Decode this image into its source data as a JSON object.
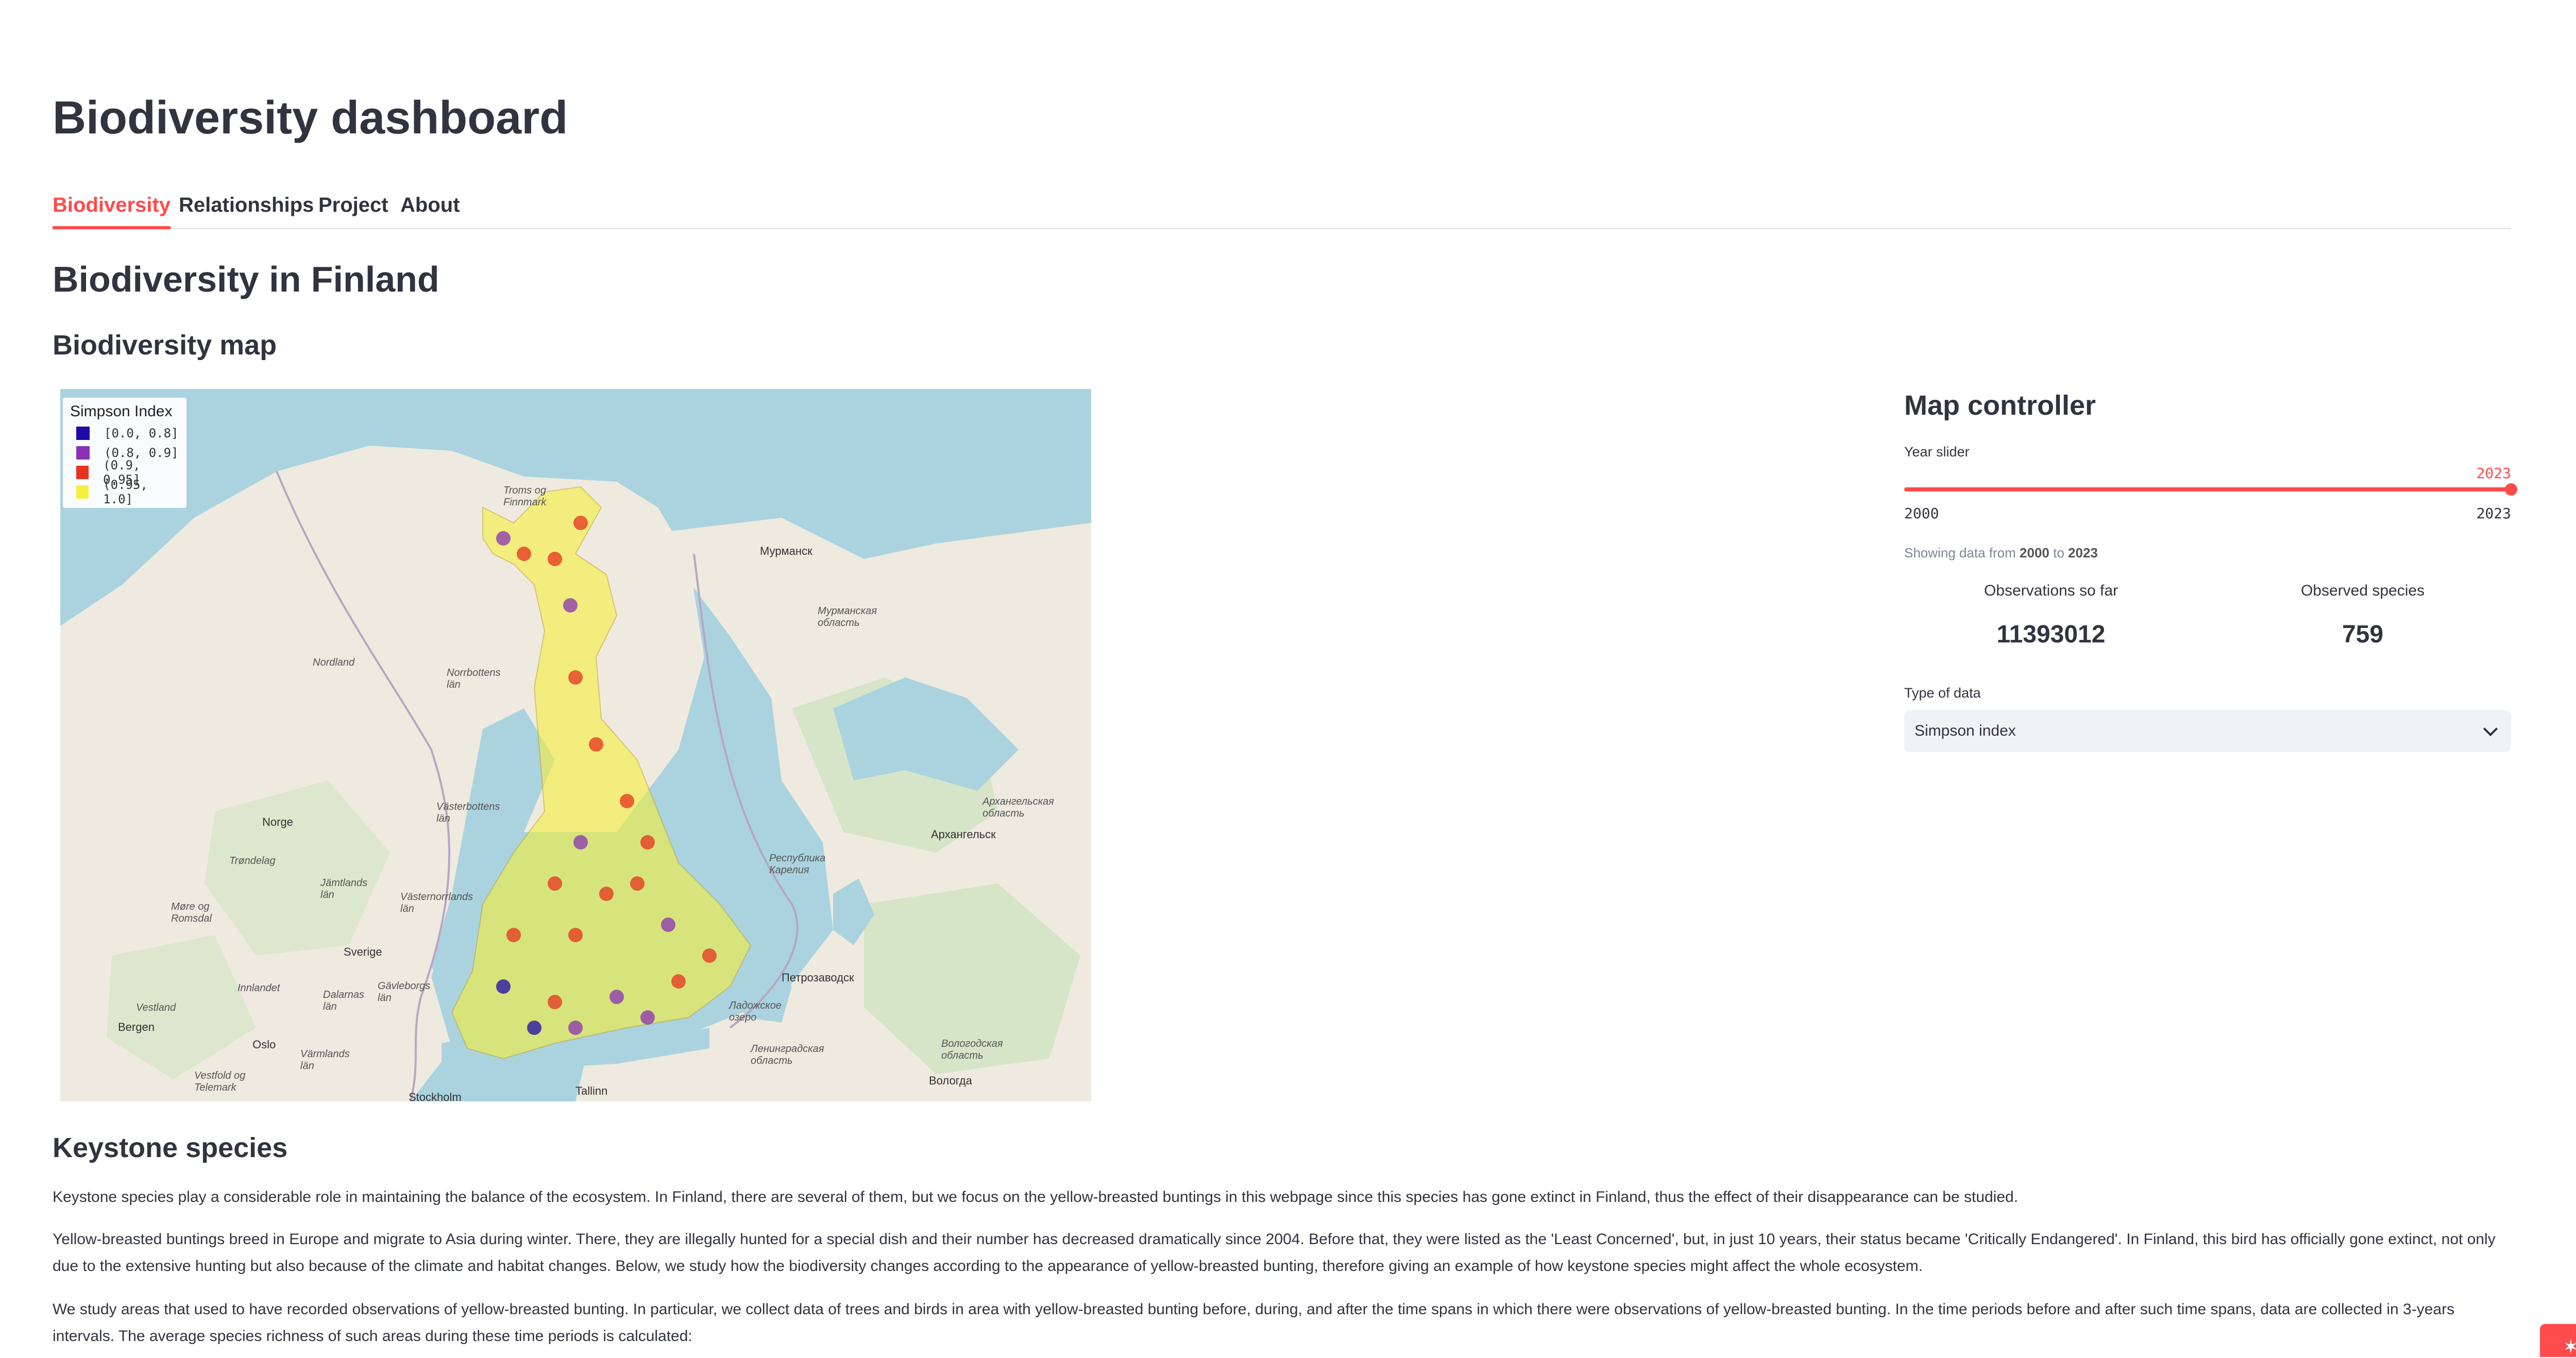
{
  "page": {
    "title": "Biodiversity dashboard",
    "tabs": [
      "Biodiversity",
      "Relationships",
      "Project",
      "About"
    ],
    "active_tab": "Biodiversity",
    "section_title": "Biodiversity in Finland",
    "map_title": "Biodiversity map"
  },
  "map": {
    "legend_title": "Simpson Index",
    "legend": [
      {
        "label": "[0.0, 0.8]",
        "color": "#1e0aa8"
      },
      {
        "label": "(0.8, 0.9]",
        "color": "#8a32b4"
      },
      {
        "label": "(0.9, 0.95]",
        "color": "#e6321e"
      },
      {
        "label": "(0.95, 1.0]",
        "color": "#f5f03c"
      }
    ],
    "labels": {
      "murmansk": "Мурманск",
      "murmansk_oblast": "Мурманская область",
      "troms": "Troms og Finnmark",
      "nordland": "Nordland",
      "norrbotten": "Norrbottens län",
      "vasterbotten": "Västerbottens län",
      "norge": "Norge",
      "trondelag": "Trøndelag",
      "jamtlands": "Jämtlands län",
      "more": "Møre og Romsdal",
      "vasternorrland": "Västernorrlands län",
      "sverige": "Sverige",
      "innlandet": "Innlandet",
      "gavleborg": "Gävleborgs län",
      "dalarnas": "Dalarnas län",
      "vestland": "Vestland",
      "bergen": "Bergen",
      "oslo": "Oslo",
      "varmlands": "Värmlands län",
      "vestfold": "Vestfold og Telemark",
      "stockholm": "Stockholm",
      "tallinn": "Tallinn",
      "arkhangelsk": "Архангельск",
      "arkhangelsk_oblast": "Архангельская область",
      "karelia": "Республика Карелия",
      "petrozavodsk": "Петрозаводск",
      "ladoga": "Ладожское озеро",
      "leningrad": "Ленинградская область",
      "vologda_oblast": "Вологодская область",
      "vologda": "Вологда"
    }
  },
  "controller": {
    "title": "Map controller",
    "slider_label": "Year slider",
    "slider_min": "2000",
    "slider_max": "2023",
    "slider_value": "2023",
    "showing_prefix": "Showing data from",
    "showing_from": "2000",
    "showing_to_word": "to",
    "showing_to": "2023",
    "metrics": [
      {
        "label": "Observations so far",
        "value": "11393012"
      },
      {
        "label": "Observed species",
        "value": "759"
      }
    ],
    "type_label": "Type of data",
    "type_value": "Simpson index"
  },
  "keystone": {
    "title": "Keystone species",
    "p1": "Keystone species play a considerable role in maintaining the balance of the ecosystem. In Finland, there are several of them, but we focus on the yellow-breasted buntings in this webpage since this species has gone extinct in Finland, thus the effect of their disappearance can be studied.",
    "p2": "Yellow-breasted buntings breed in Europe and migrate to Asia during winter. There, they are illegally hunted for a special dish and their number has decreased dramatically since 2004. Before that, they were listed as the 'Least Concerned', but, in just 10 years, their status became 'Critically Endangered'. In Finland, this bird has officially gone extinct, not only due to the extensive hunting but also because of the climate and habitat changes. Below, we study how the biodiversity changes according to the appearance of yellow-breasted bunting, therefore giving an example of how keystone species might affect the whole ecosystem.",
    "p3": "We study areas that used to have recorded observations of yellow-breasted bunting. In particular, we collect data of trees and birds in area with yellow-breasted bunting before, during, and after the time spans in which there were observations of yellow-breasted bunting. In the time periods before and after such time spans, data are collected in 3-years intervals. The average species richness of such areas during these time periods is calculated:"
  }
}
